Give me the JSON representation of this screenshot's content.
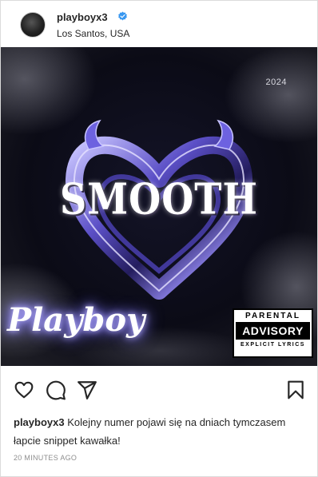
{
  "post": {
    "username": "playboyx3",
    "location": "Los Santos, USA",
    "verified": true,
    "caption_text": "Kolejny numer pojawi się na dniach tymczasem łapcie snippet kawałka!",
    "timestamp": "20 MINUTES AGO"
  },
  "artwork": {
    "year": "2024",
    "title": "SMOOTH",
    "artist": "Playboy",
    "advisory": {
      "top": "PARENTAL",
      "middle": "ADVISORY",
      "bottom": "EXPLICIT LYRICS"
    }
  },
  "icons": {
    "verified": "verified-badge-icon",
    "like": "heart-icon",
    "comment": "comment-bubble-icon",
    "share": "paper-plane-icon",
    "save": "bookmark-icon"
  },
  "colors": {
    "verified": "#3897f0",
    "text": "#262626",
    "muted": "#8e8e8e",
    "glow": "#8a80ff"
  }
}
